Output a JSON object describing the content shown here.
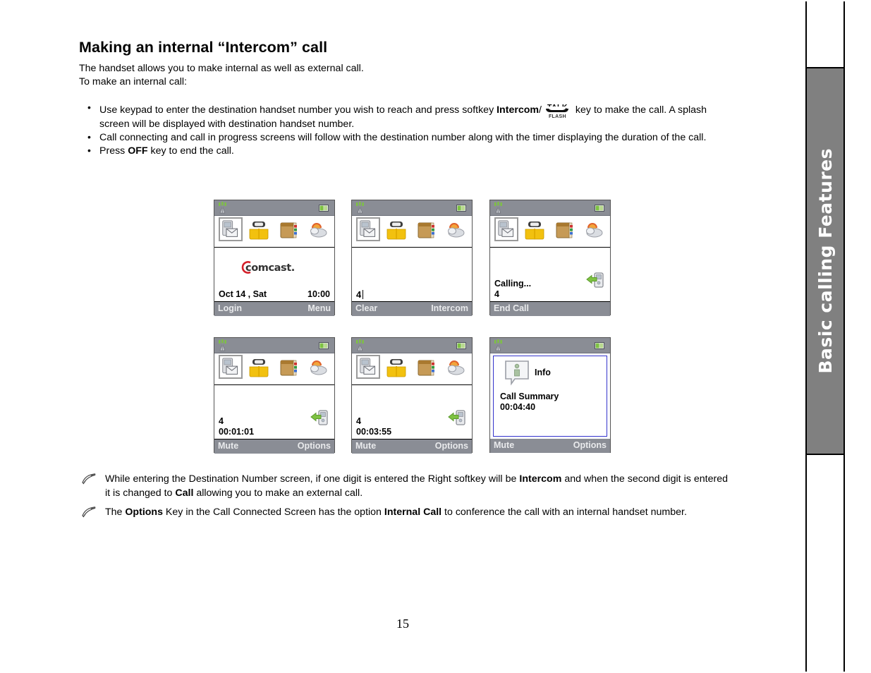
{
  "document": {
    "heading": "Making an internal “Intercom” call",
    "intro_lines": [
      "The handset allows you to make internal as well as external call.",
      "To make an internal call:"
    ],
    "bullets": [
      {
        "part1": "Use keypad to enter the destination handset number you wish to reach and press softkey ",
        "bold1": "Intercom",
        "part2": "/",
        "key_icon": {
          "top": "TALK",
          "bottom": "FLASH"
        },
        "part3": " key to make the call. A splash screen will be displayed with destination handset number."
      },
      {
        "part1": "Call connecting and call in progress screens will follow with the destination number along with the timer displaying the duration of the call."
      },
      {
        "part1": "Press ",
        "bold1": "OFF",
        "part3": " key to end the call."
      }
    ],
    "notes": [
      {
        "s1": "While entering the Destination Number screen, if one digit is entered the Right softkey will be ",
        "b1": "Intercom",
        "s2": " and when the second digit is entered it is changed to ",
        "b2": "Call",
        "s3": " allowing you to make an external call."
      },
      {
        "s1": "The ",
        "b1": "Options",
        "s2": " Key in the Call Connected Screen has the option ",
        "b2": "Internal Call",
        "s3": " to conference the call with an internal handset number."
      }
    ],
    "page_number": "15",
    "side_tab_label": "Basic calling Features"
  },
  "phone_screens": [
    {
      "name": "idle-splash-screen",
      "status": {
        "signal": "antenna-icon",
        "battery": "battery-icon"
      },
      "app_icons": [
        "voicemail-icon",
        "phonebook-icon",
        "addressbook-icon",
        "weather-icon"
      ],
      "logo_text": "comcast.",
      "date": "Oct 14 , Sat",
      "time": "10:00",
      "softkey_left": "Login",
      "softkey_right": "Menu"
    },
    {
      "name": "destination-number-entry-screen",
      "dialed_digits": "4",
      "softkey_left": "Clear",
      "softkey_right": "Intercom"
    },
    {
      "name": "calling-screen",
      "line1": "Calling...",
      "line2": "4",
      "call_icon": "outgoing-call-icon",
      "softkey_left": "End Call",
      "softkey_right": ""
    },
    {
      "name": "call-in-progress-screen-1",
      "line1": "4",
      "line2": "00:01:01",
      "call_icon": "outgoing-call-icon",
      "softkey_left": "Mute",
      "softkey_right": "Options"
    },
    {
      "name": "call-in-progress-screen-2",
      "line1": "4",
      "line2": "00:03:55",
      "call_icon": "outgoing-call-icon",
      "softkey_left": "Mute",
      "softkey_right": "Options"
    },
    {
      "name": "call-summary-screen",
      "dialog_title": "Info",
      "dialog_line1": "Call Summary",
      "dialog_line2": "00:04:40",
      "softkey_left": "Mute",
      "softkey_right": "Options"
    }
  ],
  "colors": {
    "status_bar": "#8a8d95",
    "soft_bar": "#8a8d95",
    "side_tab": "#808080",
    "dialog_border": "#3333cc",
    "comcast_red": "#d4202a",
    "call_icon_green": "#7bb447"
  }
}
